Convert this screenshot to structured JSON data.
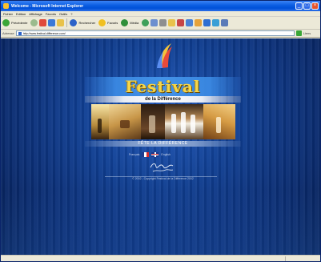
{
  "window": {
    "title": "Welcome - Microsoft Internet Explorer",
    "controls": {
      "minimize": "_",
      "maximize": "□",
      "close": "×"
    }
  },
  "menubar": {
    "items": [
      "Fichier",
      "Edition",
      "Affichage",
      "Favoris",
      "Outils",
      "?"
    ]
  },
  "toolbar": {
    "back_label": "Précédente",
    "search_label": "Rechercher",
    "favorites_label": "Favoris",
    "media_label": "Média"
  },
  "addressbar": {
    "label": "Adresse",
    "url": "http://www.festival-difference.com/",
    "links_label": "Liens"
  },
  "page": {
    "title_main": "Festival",
    "title_sub": "de la Différence",
    "menu_band": "FÊTE LA DIFFÉRENCE",
    "lang_fr": "Français",
    "lang_en": "English",
    "copyright": "© 2002 - Copyright Festival de la Différence 2002"
  },
  "statusbar": {
    "text": ""
  },
  "colors": {
    "title_bar": "#0a5ce1",
    "page_background": "#103f93",
    "festival_gold": "#f5d64a"
  }
}
